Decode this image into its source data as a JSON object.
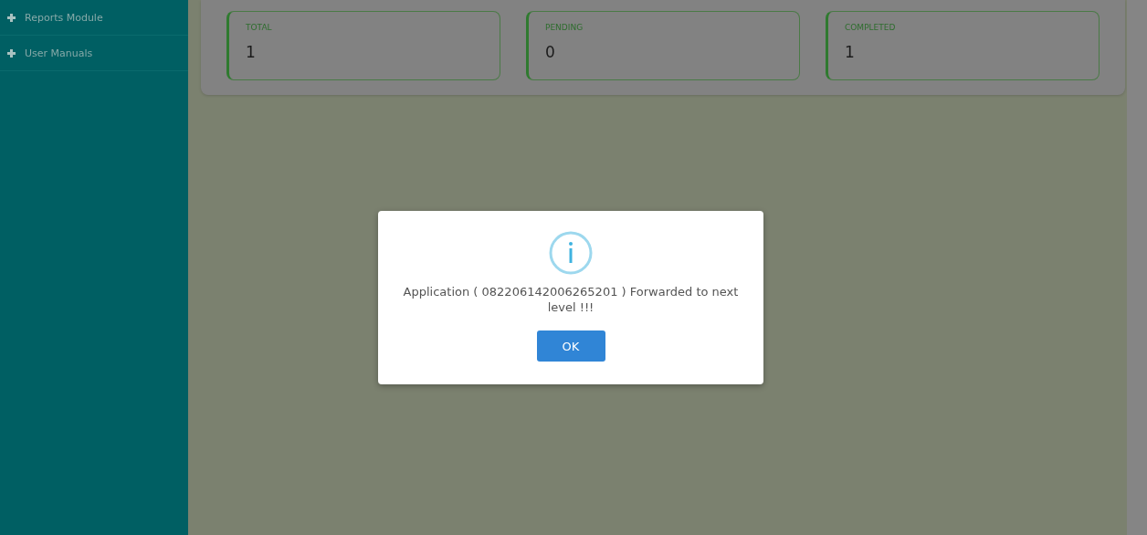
{
  "sidebar": {
    "items": [
      {
        "label": "Reports Module"
      },
      {
        "label": "User Manuals"
      }
    ]
  },
  "stats": [
    {
      "label": "TOTAL",
      "value": "1"
    },
    {
      "label": "PENDING",
      "value": "0"
    },
    {
      "label": "COMPLETED",
      "value": "1"
    }
  ],
  "dialog": {
    "message": "Application ( 082206142006265201 ) Forwarded to next level !!!",
    "button": "OK"
  }
}
